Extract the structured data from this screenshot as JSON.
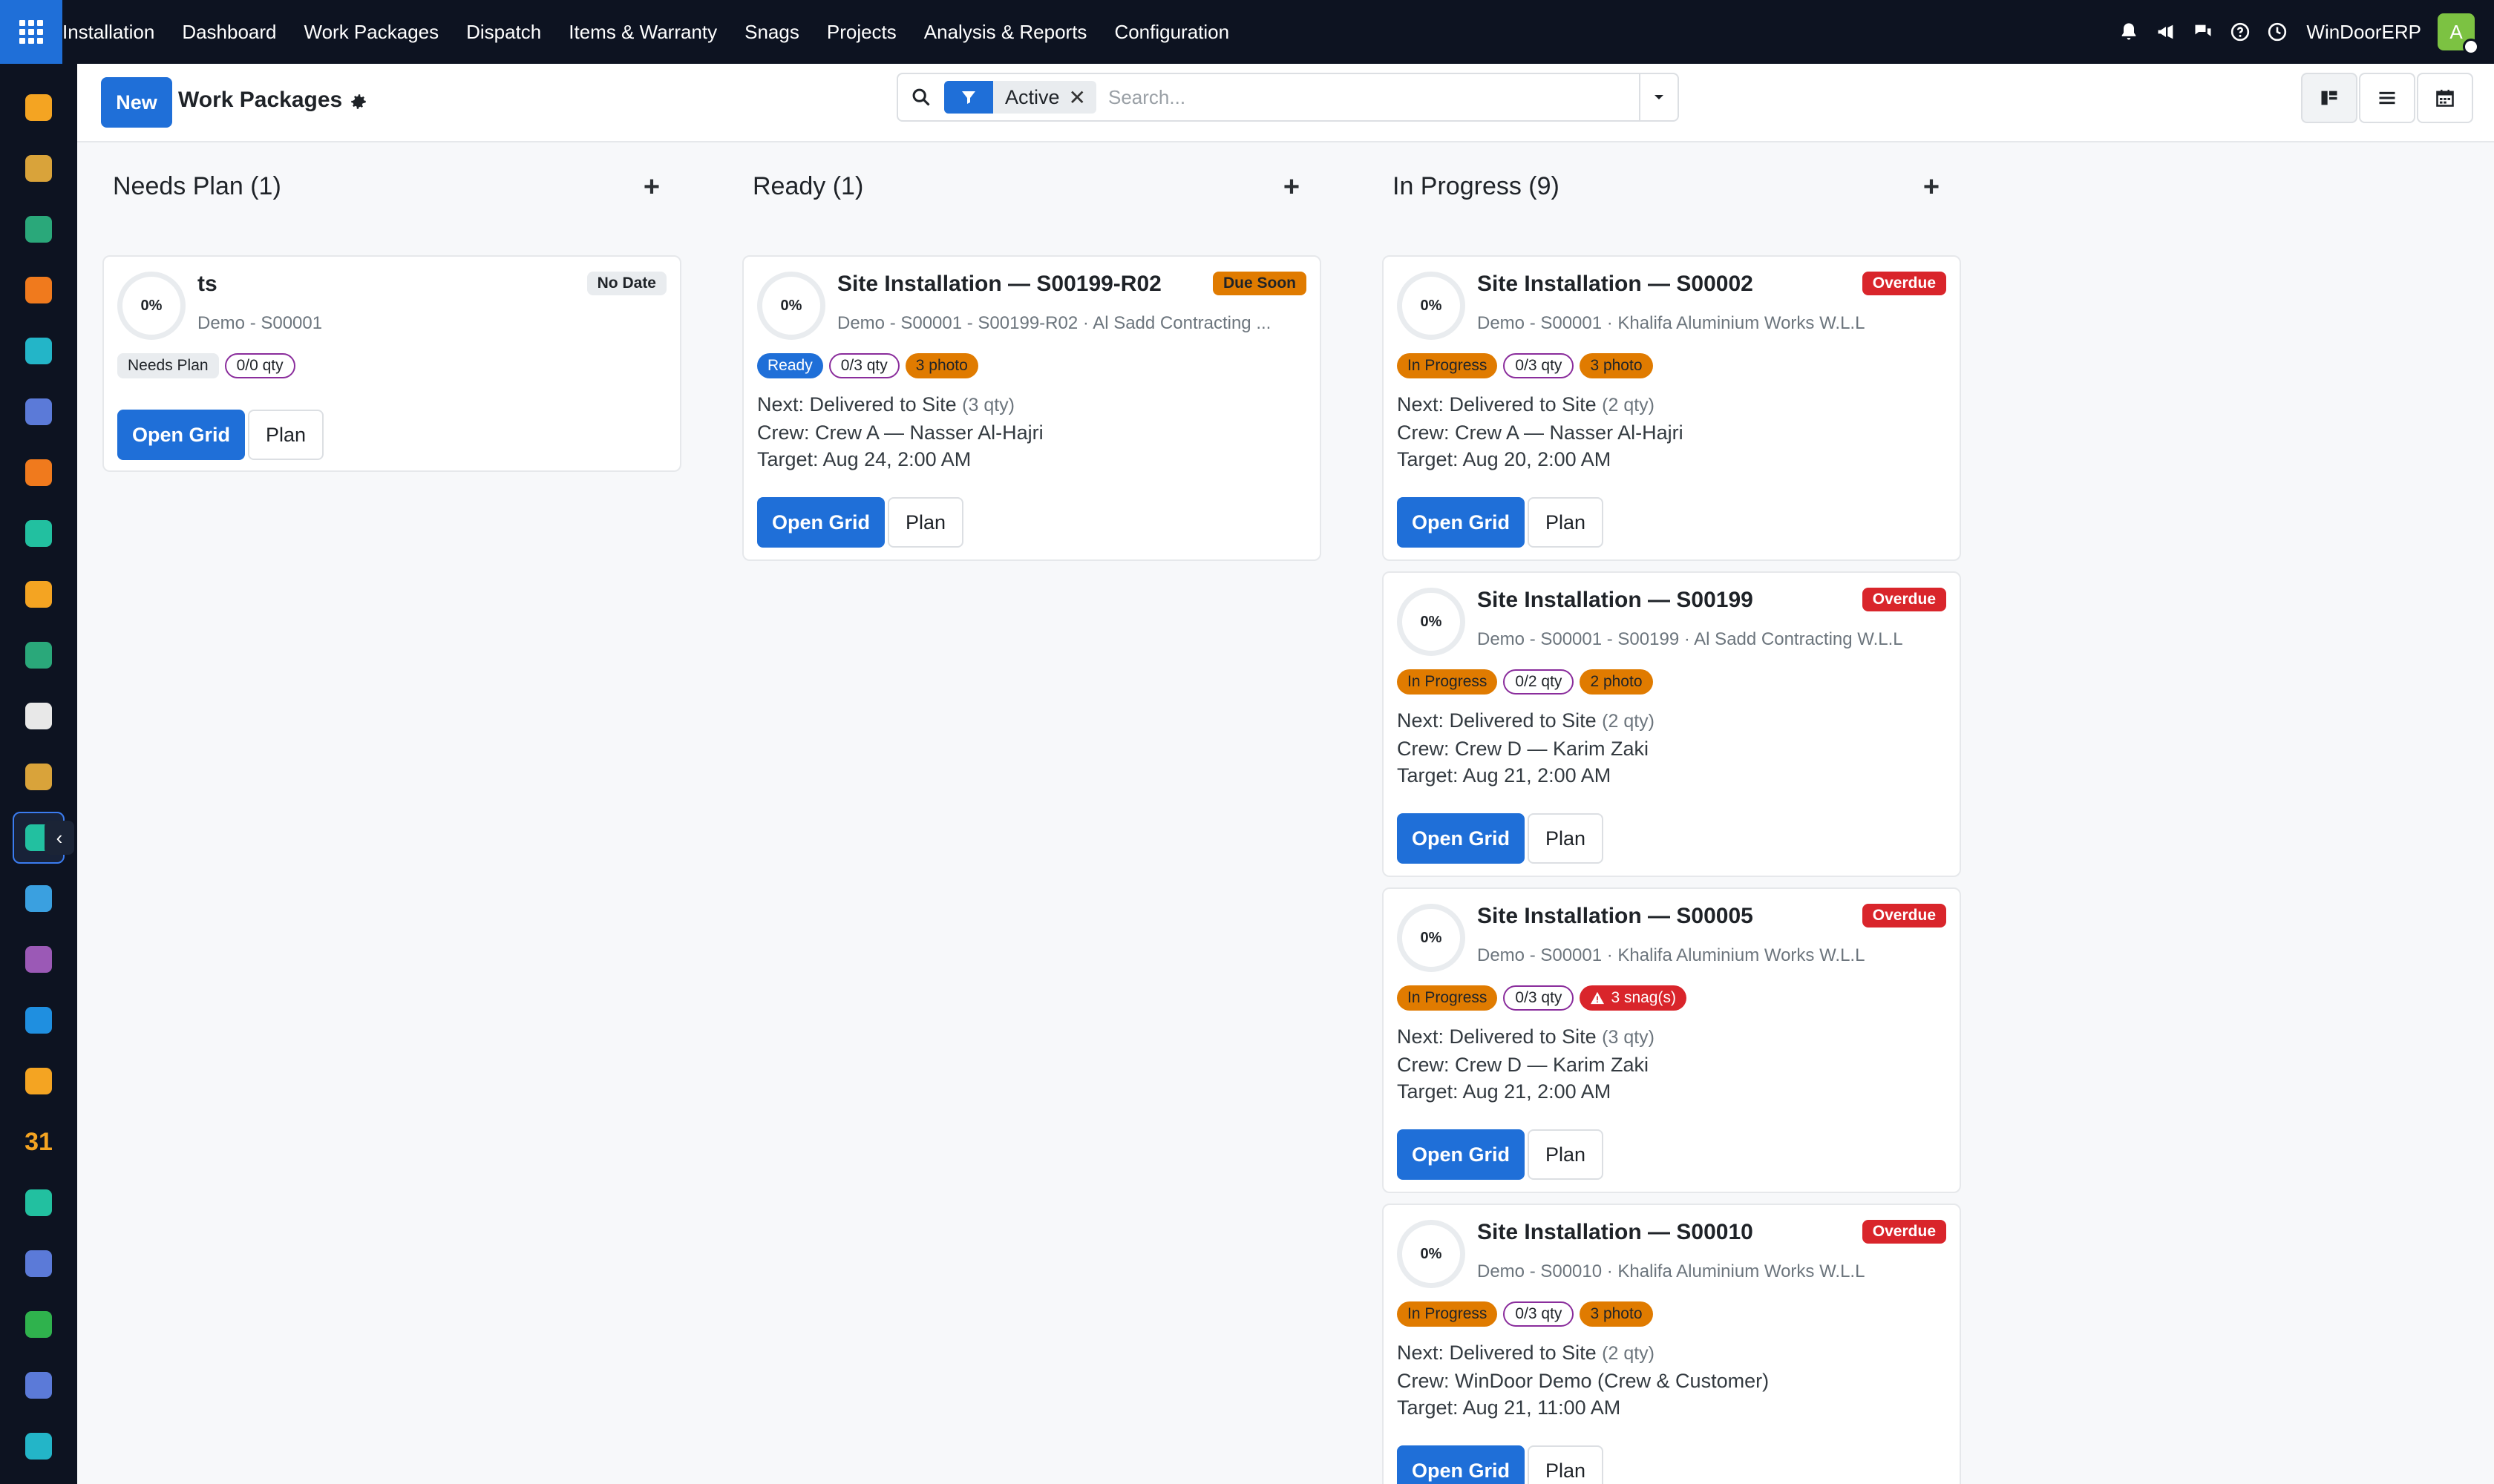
{
  "topbar": {
    "brand": "Installation",
    "menu": [
      "Dashboard",
      "Work Packages",
      "Dispatch",
      "Items & Warranty",
      "Snags",
      "Projects",
      "Analysis & Reports",
      "Configuration"
    ],
    "company": "WinDoorERP",
    "user_initial": "A",
    "icons": [
      "bell-icon",
      "megaphone-icon",
      "chat-icon",
      "help-icon",
      "clock-icon"
    ]
  },
  "sidebar": {
    "items": [
      {
        "name": "reporting-app-icon",
        "color": "#f4a422"
      },
      {
        "name": "marketing-app-icon",
        "color": "#d9a33a"
      },
      {
        "name": "contacts-app-icon",
        "color": "#2aa87a"
      },
      {
        "name": "discuss-app-icon",
        "color": "#f07a1d"
      },
      {
        "name": "social-app-icon",
        "color": "#23b5c8"
      },
      {
        "name": "mail-app-icon",
        "color": "#5b7ad8"
      },
      {
        "name": "live-chat-app-icon",
        "color": "#f07a1d"
      },
      {
        "name": "field-app-icon",
        "color": "#22c0a0"
      },
      {
        "name": "charts-app-icon",
        "color": "#f4a422"
      },
      {
        "name": "employees-app-icon",
        "color": "#2aa87a"
      },
      {
        "name": "inventory-app-icon",
        "color": "#e8e8e8"
      },
      {
        "name": "studio-app-icon",
        "color": "#d9a33a"
      },
      {
        "name": "installation-app-icon",
        "color": "#22c0a0"
      },
      {
        "name": "knowledge-app-icon",
        "color": "#3aa0e0"
      },
      {
        "name": "product-app-icon",
        "color": "#9b59b6"
      },
      {
        "name": "invoicing-app-icon",
        "color": "#1f8fe0"
      },
      {
        "name": "team-app-icon",
        "color": "#f4a422"
      },
      {
        "name": "calendar-app-icon",
        "color": "#f4a422"
      },
      {
        "name": "sign-app-icon",
        "color": "#22c0a0"
      },
      {
        "name": "dashboard-app-icon",
        "color": "#5b7ad8"
      },
      {
        "name": "whatsapp-app-icon",
        "color": "#2fb24d"
      },
      {
        "name": "timer-app-icon",
        "color": "#5b7ad8"
      },
      {
        "name": "helpdesk-app-icon",
        "color": "#23b5c8"
      }
    ],
    "calendar_text": "31"
  },
  "control": {
    "new_label": "New",
    "title": "Work Packages",
    "facet_value": "Active",
    "search_placeholder": "Search..."
  },
  "columns": [
    {
      "title": "Needs Plan (1)",
      "cards": [
        {
          "progress": "0%",
          "title": "ts",
          "subtitle": "Demo - S00001",
          "deadline": "No Date",
          "deadline_type": "nodate",
          "badges": [
            {
              "text": "Needs Plan",
              "type": "needs"
            },
            {
              "text": "0/0 qty",
              "type": "qty"
            }
          ],
          "next_label": "",
          "next_qty": "",
          "crew": "",
          "target": "",
          "open_label": "Open Grid",
          "plan_label": "Plan"
        }
      ]
    },
    {
      "title": "Ready (1)",
      "cards": [
        {
          "progress": "0%",
          "title": "Site Installation — S00199-R02",
          "subtitle": "Demo - S00001 - S00199-R02 · Al Sadd Contracting ...",
          "deadline": "Due Soon",
          "deadline_type": "soon",
          "badges": [
            {
              "text": "Ready",
              "type": "ready"
            },
            {
              "text": "0/3 qty",
              "type": "qty"
            },
            {
              "text": "3 photo",
              "type": "photo"
            }
          ],
          "next_label": "Next: Delivered to Site",
          "next_qty": "(3 qty)",
          "crew": "Crew: Crew A — Nasser Al-Hajri",
          "target": "Target: Aug 24, 2:00 AM",
          "open_label": "Open Grid",
          "plan_label": "Plan"
        }
      ]
    },
    {
      "title": "In Progress (9)",
      "cards": [
        {
          "progress": "0%",
          "title": "Site Installation — S00002",
          "subtitle": "Demo - S00001 · Khalifa Aluminium Works W.L.L",
          "deadline": "Overdue",
          "deadline_type": "overdue",
          "badges": [
            {
              "text": "In Progress",
              "type": "prog"
            },
            {
              "text": "0/3 qty",
              "type": "qty"
            },
            {
              "text": "3 photo",
              "type": "photo"
            }
          ],
          "next_label": "Next: Delivered to Site",
          "next_qty": "(2 qty)",
          "crew": "Crew: Crew A — Nasser Al-Hajri",
          "target": "Target: Aug 20, 2:00 AM",
          "open_label": "Open Grid",
          "plan_label": "Plan"
        },
        {
          "progress": "0%",
          "title": "Site Installation — S00199",
          "subtitle": "Demo - S00001 - S00199 · Al Sadd Contracting W.L.L",
          "deadline": "Overdue",
          "deadline_type": "overdue",
          "badges": [
            {
              "text": "In Progress",
              "type": "prog"
            },
            {
              "text": "0/2 qty",
              "type": "qty"
            },
            {
              "text": "2 photo",
              "type": "photo"
            }
          ],
          "next_label": "Next: Delivered to Site",
          "next_qty": "(2 qty)",
          "crew": "Crew: Crew D — Karim Zaki",
          "target": "Target: Aug 21, 2:00 AM",
          "open_label": "Open Grid",
          "plan_label": "Plan"
        },
        {
          "progress": "0%",
          "title": "Site Installation — S00005",
          "subtitle": "Demo - S00001 · Khalifa Aluminium Works W.L.L",
          "deadline": "Overdue",
          "deadline_type": "overdue",
          "badges": [
            {
              "text": "In Progress",
              "type": "prog"
            },
            {
              "text": "0/3 qty",
              "type": "qty"
            },
            {
              "text": "3 snag(s)",
              "type": "snag"
            }
          ],
          "next_label": "Next: Delivered to Site",
          "next_qty": "(3 qty)",
          "crew": "Crew: Crew D — Karim Zaki",
          "target": "Target: Aug 21, 2:00 AM",
          "open_label": "Open Grid",
          "plan_label": "Plan"
        },
        {
          "progress": "0%",
          "title": "Site Installation — S00010",
          "subtitle": "Demo - S00010 · Khalifa Aluminium Works W.L.L",
          "deadline": "Overdue",
          "deadline_type": "overdue",
          "badges": [
            {
              "text": "In Progress",
              "type": "prog"
            },
            {
              "text": "0/3 qty",
              "type": "qty"
            },
            {
              "text": "3 photo",
              "type": "photo"
            }
          ],
          "next_label": "Next: Delivered to Site",
          "next_qty": "(2 qty)",
          "crew": "Crew: WinDoor Demo (Crew & Customer)",
          "target": "Target: Aug 21, 11:00 AM",
          "open_label": "Open Grid",
          "plan_label": "Plan"
        }
      ]
    }
  ]
}
